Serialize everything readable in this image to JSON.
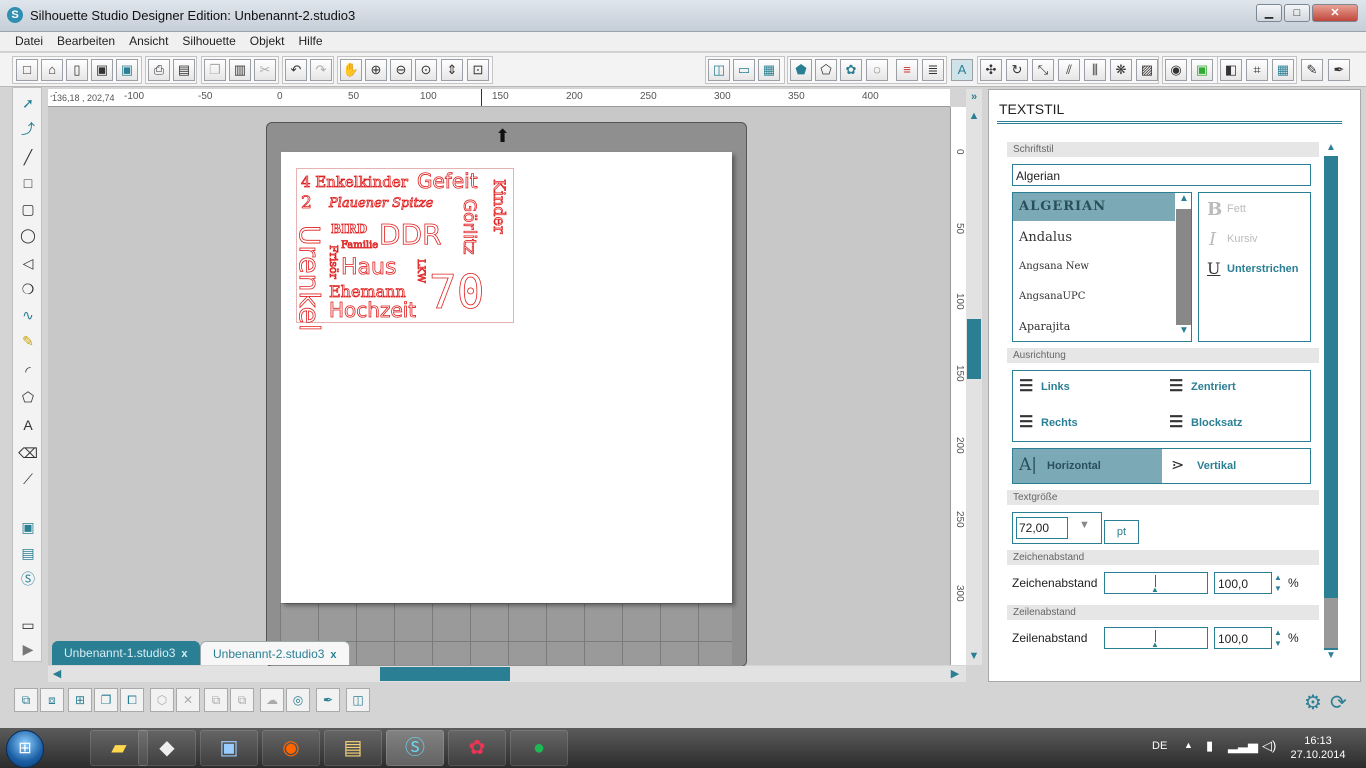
{
  "window": {
    "title": "Silhouette Studio Designer Edition: Unbenannt-2.studio3",
    "logo_letter": "S",
    "minimize": "▁",
    "maximize": "□",
    "close": "✕"
  },
  "menu": [
    "Datei",
    "Bearbeiten",
    "Ansicht",
    "Silhouette",
    "Objekt",
    "Hilfe"
  ],
  "ruler": {
    "coords": "136,18 , 202,74",
    "top_labels": [
      "-1",
      "-100",
      "-50",
      "0",
      "50",
      "100",
      "150",
      "200",
      "250",
      "300",
      "350",
      "400"
    ],
    "left_labels": [
      "0",
      "50",
      "100",
      "150",
      "200",
      "250",
      "300"
    ]
  },
  "canvas_text": {
    "line1": "4 Enkelkinder",
    "gefeit": "Gefeit",
    "two": "2",
    "kinder": "Kinder",
    "plauener": "Plauener Spitze",
    "bird": "BIRD",
    "ddr": "DDR",
    "goertz": "Görlitz",
    "familie": "Familie",
    "urenkel": "Urenkel",
    "friseur": "Frisör",
    "haus": "Haus",
    "lkw": "LKW",
    "seventy": "70",
    "ehemann": "Ehemann",
    "hochzeit": "Hochzeit"
  },
  "tabs": [
    {
      "label": "Unbenannt-1.studio3",
      "close": "x"
    },
    {
      "label": "Unbenannt-2.studio3",
      "close": "x"
    }
  ],
  "panel": {
    "title": "TEXTSTIL",
    "schriftstil_label": "Schriftstil",
    "font_search": "Algerian",
    "fonts": [
      "ALGERIAN",
      "Andalus",
      "Angsana New",
      "AngsanaUPC",
      "Aparajita"
    ],
    "style_bold": "Fett",
    "style_italic": "Kursiv",
    "style_underline": "Unterstrichen",
    "style_bold_icon": "B",
    "style_italic_icon": "I",
    "style_underline_icon": "U",
    "ausrichtung_label": "Ausrichtung",
    "align_left": "Links",
    "align_center": "Zentriert",
    "align_right": "Rechts",
    "align_justify": "Blocksatz",
    "horizontal": "Horizontal",
    "vertical": "Vertikal",
    "textgroesse_label": "Textgröße",
    "size_value": "72,00",
    "size_unit": "pt",
    "zeichenabstand_label": "Zeichenabstand",
    "zeichenabstand_text": "Zeichenabstand",
    "zeichenabstand_value": "100,0",
    "zeilenabstand_label": "Zeilenabstand",
    "zeilenabstand_text": "Zeilenabstand",
    "zeilenabstand_value": "100,0",
    "percent": "%"
  },
  "taskbar": {
    "lang": "DE",
    "time": "16:13",
    "date": "27.10.2014"
  }
}
